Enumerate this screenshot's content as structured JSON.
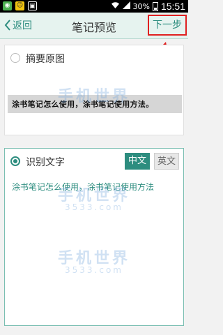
{
  "status_bar": {
    "battery": "30%",
    "time": "15:51"
  },
  "app_bar": {
    "back_label": "返回",
    "title": "笔记预览",
    "next_label": "下一步"
  },
  "original_section": {
    "label": "摘要原图",
    "image_text": "涂书笔记怎么使用，涂书笔记使用方法。"
  },
  "recognition_section": {
    "label": "识别文字",
    "lang_chinese": "中文",
    "lang_english": "英文",
    "recognized_text": "涂书笔记怎么使用，涂书笔记使用方法"
  },
  "watermark": {
    "brand": "手机世界",
    "domain": "3533.com"
  },
  "colors": {
    "accent": "#2d8d7f",
    "annotation": "#e02020"
  }
}
